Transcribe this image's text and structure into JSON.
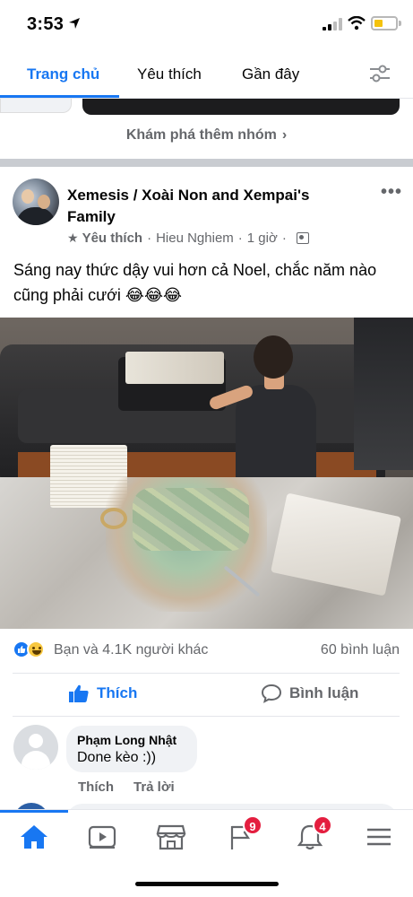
{
  "status_bar": {
    "time": "3:53"
  },
  "tabs": [
    {
      "label": "Trang chủ",
      "active": true
    },
    {
      "label": "Yêu thích",
      "active": false
    },
    {
      "label": "Gần đây",
      "active": false
    }
  ],
  "explore_groups": "Khám phá thêm nhóm",
  "post": {
    "title": "Xemesis / Xoài Non and Xempai's Family",
    "favorite": "Yêu thích",
    "author": "Hieu Nghiem",
    "time": "1 giờ",
    "text": "Sáng nay thức dậy vui hơn cả Noel, chắc năm nào cũng phải cưới 😂😂😂",
    "reactions_text": "Bạn và 4.1K người khác",
    "comments_count": "60 bình luận",
    "like_label": "Thích",
    "comment_label": "Bình luận"
  },
  "comment": {
    "name": "Phạm Long Nhật",
    "text": "Done kèo :))",
    "like": "Thích",
    "reply": "Trả lời"
  },
  "bottom_nav": {
    "items": [
      "home-icon",
      "video-icon",
      "marketplace-icon",
      "groups-icon",
      "notifications-icon",
      "menu-icon"
    ],
    "groups_badge": "9",
    "notifications_badge": "4"
  },
  "colors": {
    "accent": "#1877f2",
    "badge": "#e41e3f"
  }
}
